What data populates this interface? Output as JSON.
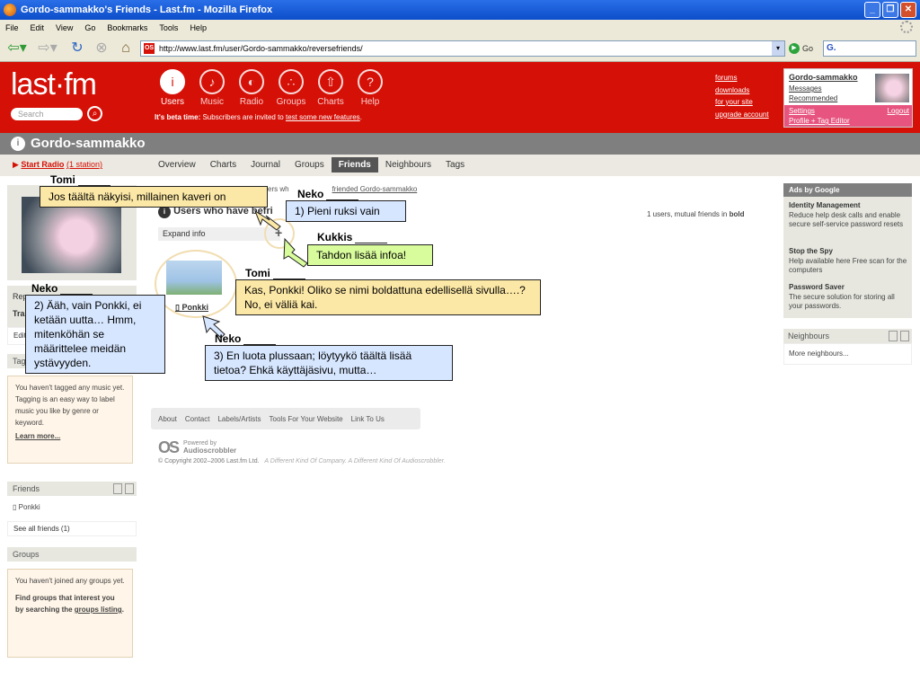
{
  "browser": {
    "title": "Gordo-sammakko's Friends - Last.fm - Mozilla Firefox",
    "menu": [
      "File",
      "Edit",
      "View",
      "Go",
      "Bookmarks",
      "Tools",
      "Help"
    ],
    "url": "http://www.last.fm/user/Gordo-sammakko/reversefriends/",
    "go_label": "Go",
    "search_label": "G."
  },
  "header": {
    "logo": "last·fm",
    "search_placeholder": "Search",
    "nav": [
      {
        "label": "Users",
        "glyph": "i"
      },
      {
        "label": "Music",
        "glyph": "♪"
      },
      {
        "label": "Radio",
        "glyph": "◐"
      },
      {
        "label": "Groups",
        "glyph": "∴"
      },
      {
        "label": "Charts",
        "glyph": "⇧"
      },
      {
        "label": "Help",
        "glyph": "?"
      }
    ],
    "beta_bold": "It's beta time:",
    "beta_text": " Subscribers are invited to ",
    "beta_link": "test some new features",
    "beta_end": ".",
    "links": [
      "forums",
      "downloads",
      "for your site",
      "upgrade account"
    ],
    "user": {
      "name": "Gordo-sammakko",
      "messages": "Messages",
      "recommended": "Recommended",
      "settings": "Settings",
      "logout": "Logout",
      "profile_editor": "Profile + Tag Editor"
    }
  },
  "profile": {
    "name": "Gordo-sammakko",
    "start_radio": "Start Radio",
    "stations": "(1 station)",
    "tabs": [
      "Overview",
      "Charts",
      "Journal",
      "Groups",
      "Friends",
      "Neighbours",
      "Tags"
    ]
  },
  "left": {
    "box1_label": "Rep",
    "box1_sub": "Tra",
    "box2_label": "Edit",
    "tags_head": "Tag",
    "tags_text": "You haven't tagged any music yet. Tagging is an easy way to label music you like by genre or keyword.",
    "learn_more": "Learn more...",
    "friends_head": "Friends",
    "friend": "Ponkki",
    "see_all": "See all friends (1)",
    "groups_head": "Groups",
    "groups_text1": "You haven't joined any groups yet.",
    "groups_text2": "Find groups that interest you by searching the ",
    "groups_link": "groups listing",
    "groups_end": "."
  },
  "main": {
    "crumb_pre": "ers wh",
    "crumb_link": "friended Gordo-sammakko",
    "heading": "Users who have befri",
    "count_text": "1 users, mutual friends in ",
    "count_bold": "bold",
    "expand": "Expand info",
    "expand_icon": "+",
    "friend_name": "Ponkki"
  },
  "footer": {
    "links": [
      "About",
      "Contact",
      "Labels/Artists",
      "Tools For Your Website",
      "Link To Us"
    ],
    "powered": "Powered by",
    "audioscrobbler": "Audioscrobbler",
    "copyright": "© Copyright 2002–2006 Last.fm Ltd.",
    "slogan": "A Different Kind Of Company. A Different Kind Of Audioscrobbler."
  },
  "ads": {
    "head": "Ads by Google",
    "items": [
      {
        "title": "Identity Management",
        "text": "Reduce help desk calls and enable secure self-service password resets"
      },
      {
        "title": "Stop the Spy",
        "text": "Help available here Free scan for the computers"
      },
      {
        "title": "Password Saver",
        "text": "The secure solution for storing all your passwords."
      }
    ]
  },
  "neighbours": {
    "head": "Neighbours",
    "more": "More neighbours..."
  },
  "callouts": [
    {
      "speaker": "Tomi",
      "text": "Jos täältä näkyisi, millainen kaveri on",
      "color": "#fce8a6"
    },
    {
      "speaker": "Neko",
      "text": "1) Pieni ruksi vain",
      "color": "#d6e6ff"
    },
    {
      "speaker": "Kukkis",
      "text": "Tahdon lisää infoa!",
      "color": "#d8fc9c"
    },
    {
      "speaker": "Tomi",
      "text": "Kas, Ponkki! Oliko se nimi boldattuna edellisellä sivulla….? No, ei väliä kai.",
      "color": "#fce8a6"
    },
    {
      "speaker": "Neko",
      "text": "2) Ääh, vain Ponkki, ei ketään uutta… Hmm, mitenköhän se määrittelee meidän ystävyyden.",
      "color": "#d6e6ff"
    },
    {
      "speaker": "Neko",
      "text": "3) En luota plussaan; löytyykö täältä lisää tietoa? Ehkä käyttäjäsivu, mutta…",
      "color": "#d6e6ff"
    }
  ]
}
